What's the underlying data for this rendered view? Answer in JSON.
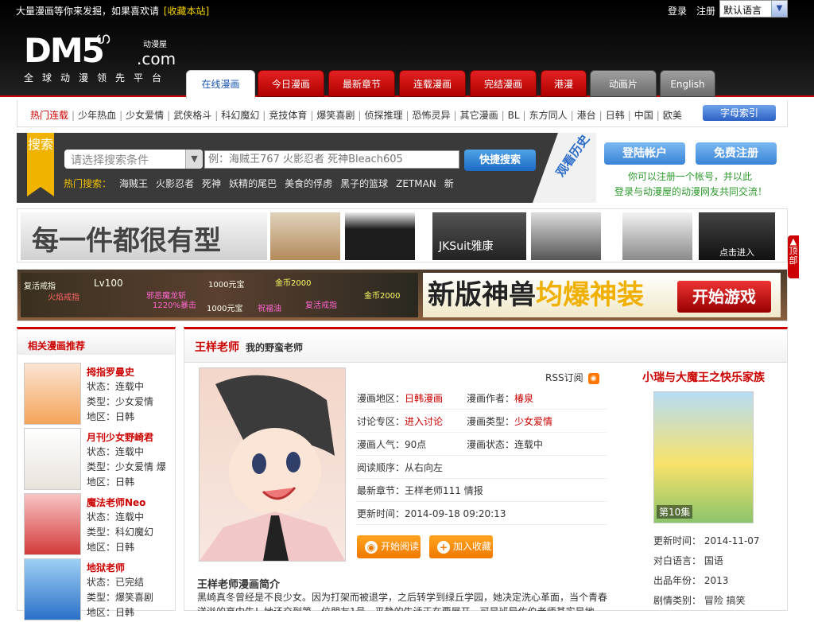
{
  "topbar": {
    "slogan": "大量漫画等你来发掘，如果喜欢请",
    "bookmark": "[收藏本站]",
    "login": "登录",
    "register": "注册",
    "language": "默认语言"
  },
  "logo": {
    "brand": "DM5",
    "com": ".com",
    "name": "动漫屋",
    "tagline": "全球动漫领先平台"
  },
  "tabs": [
    {
      "label": "在线漫画",
      "state": "active"
    },
    {
      "label": "今日漫画",
      "state": "red"
    },
    {
      "label": "最新章节",
      "state": "red"
    },
    {
      "label": "连载漫画",
      "state": "red"
    },
    {
      "label": "完结漫画",
      "state": "red"
    },
    {
      "label": "港漫",
      "state": "red"
    },
    {
      "label": "动画片",
      "state": "gray"
    },
    {
      "label": "English",
      "state": "gray"
    }
  ],
  "categories": [
    "热门连载",
    "少年热血",
    "少女爱情",
    "武侠格斗",
    "科幻魔幻",
    "竞技体育",
    "爆笑喜剧",
    "侦探推理",
    "恐怖灵异",
    "其它漫画",
    "BL",
    "东方同人",
    "港台",
    "日韩",
    "中国",
    "欧美"
  ],
  "alpha_index": "字母索引",
  "search": {
    "ribbon": "搜索",
    "select_placeholder": "请选择搜索条件",
    "keyword_placeholder": "例：海贼王767 火影忍者 死神Bleach605",
    "button": "快捷搜索",
    "hot_label": "热门搜索：",
    "hot": [
      "海贼王",
      "火影忍者",
      "死神",
      "妖精的尾巴",
      "美食的俘虏",
      "黑子的篮球",
      "ZETMAN",
      "新"
    ]
  },
  "history": "观看历史",
  "account": {
    "login_button": "登陆帐户",
    "register_button": "免费注册",
    "note1": "你可以注册一个帐号，并以此",
    "note2": "登录与动漫屋的动漫网友共同交流！"
  },
  "ads": {
    "fashion_text": "每一件都很有型",
    "fashion_tag": "JKSuit雅康",
    "game_labels": [
      "复活戒指",
      "火焰戒指",
      "Lv100",
      "邪恶魔龙斩",
      "1220%暴击",
      "1000元宝",
      "金币2000",
      "祝福油",
      "复活戒指",
      "金币2000",
      "1000元宝"
    ],
    "game_headline_a": "新版神兽",
    "game_headline_b": "均爆神装",
    "game_button": "开始游戏",
    "enter_button": "点击进入"
  },
  "to_top": "顶部",
  "sidebar": {
    "title": "相关漫画推荐",
    "items": [
      {
        "name": "拇指罗曼史",
        "status": "状态：连载中",
        "genre": "类型：少女爱情",
        "region": "地区：日韩"
      },
      {
        "name": "月刊少女野崎君",
        "status": "状态：连载中",
        "genre": "类型：少女爱情 爆",
        "region": "地区：日韩"
      },
      {
        "name": "魔法老师Neo",
        "status": "状态：连载中",
        "genre": "类型：科幻魔幻",
        "region": "地区：日韩"
      },
      {
        "name": "地狱老师",
        "status": "状态：已完结",
        "genre": "类型：爆笑喜剧",
        "region": "地区：日韩"
      }
    ]
  },
  "detail": {
    "title": "王样老师",
    "subtitle": "我的野蛮老师",
    "rss": "RSS订阅",
    "region_label": "漫画地区：",
    "region": "日韩漫画",
    "author_label": "漫画作者：",
    "author": "椿泉",
    "forum_label": "讨论专区：",
    "forum": "进入讨论",
    "genre_label": "漫画类型：",
    "genre": "少女爱情",
    "popularity": "漫画人气：90点",
    "status": "漫画状态：连载中",
    "order": "阅读顺序：从右向左",
    "latest_label": "最新章节：",
    "latest": "王样老师111 情报",
    "updated": "更新时间：2014-09-18 09:20:13",
    "read_button": "开始阅读",
    "fav_button": "加入收藏",
    "intro_title": "王样老师漫画简介",
    "intro": "黑崎真冬曾经是不良少女。因为打架而被退学，之后转学到绿丘学园，她决定洗心革面，当个青春洋溢的高中生！她还交到第一位朋友1号，平静的生活正在要展开，可是班导佐伯老师其实是地"
  },
  "related": {
    "title": "小瑞与大魔王之快乐家族",
    "episode": "第10集",
    "updated": "更新时间：  2014-11-07",
    "language": "对白语言：  国语",
    "year": "出品年份：  2013",
    "genre": "剧情类别：  冒险  搞笑"
  }
}
